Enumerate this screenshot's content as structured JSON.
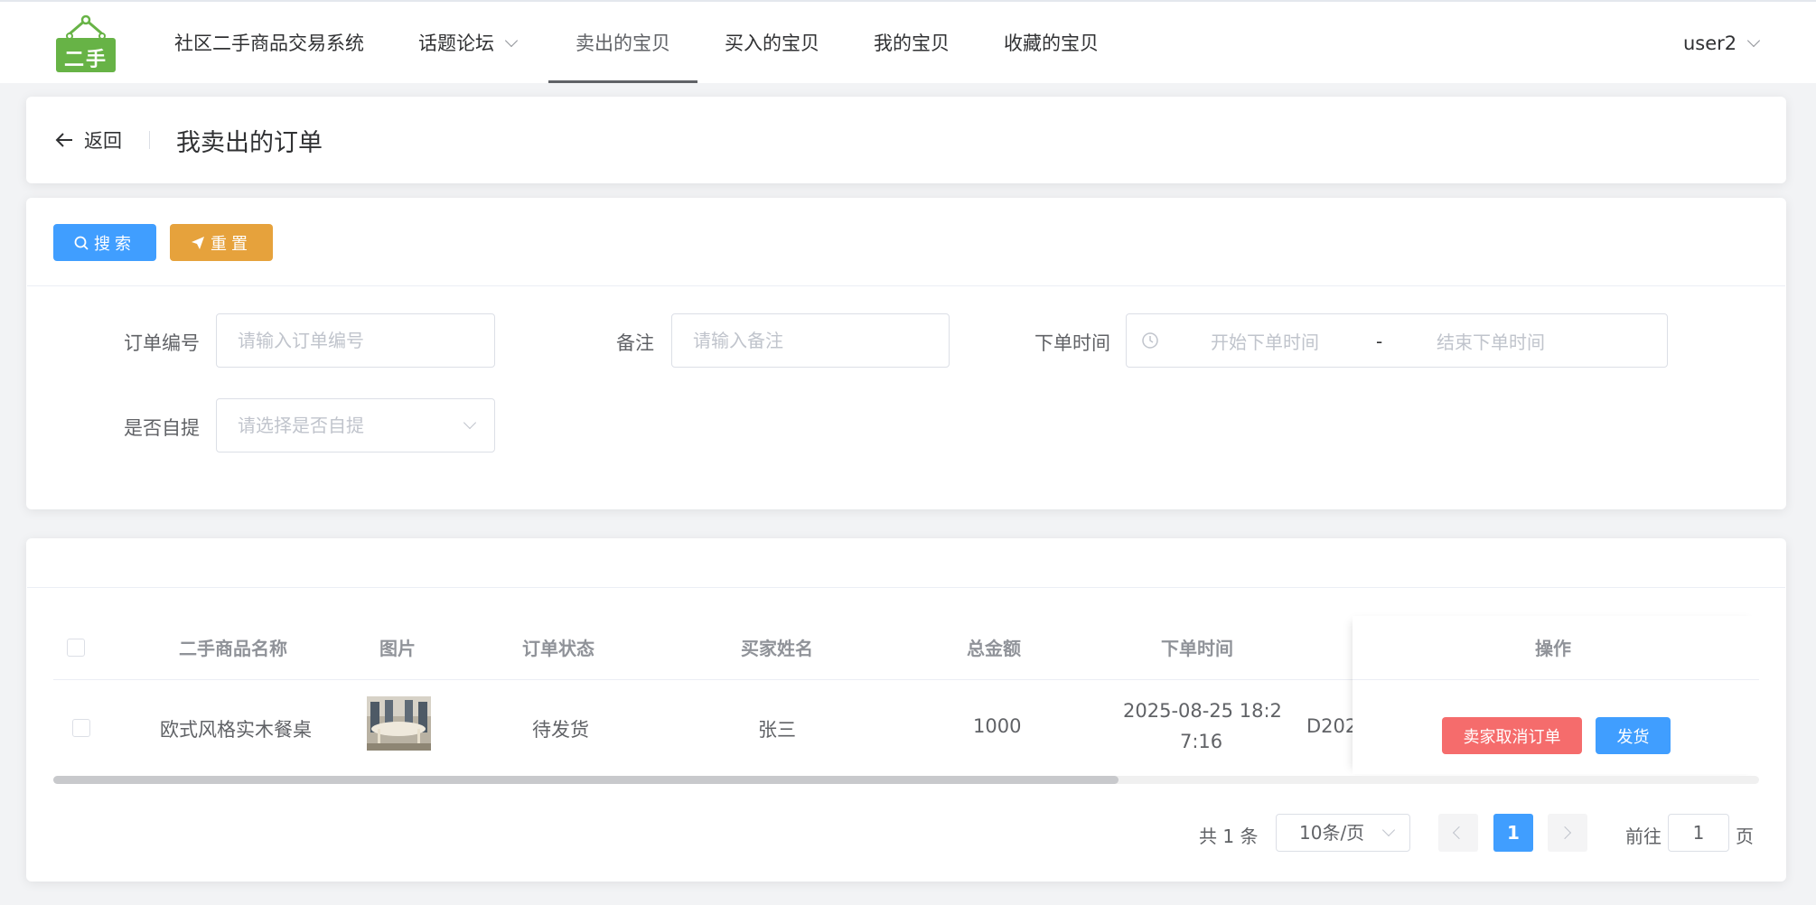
{
  "nav": {
    "logo_text": "二手",
    "brand": "社区二手商品交易系统",
    "items": [
      {
        "label": "话题论坛"
      },
      {
        "label": "卖出的宝贝"
      },
      {
        "label": "买入的宝贝"
      },
      {
        "label": "我的宝贝"
      },
      {
        "label": "收藏的宝贝"
      }
    ],
    "user": "user2"
  },
  "header": {
    "back_label": "返回",
    "title": "我卖出的订单"
  },
  "toolbar": {
    "search_label": "搜索",
    "reset_label": "重置"
  },
  "form": {
    "order_no": {
      "label": "订单编号",
      "placeholder": "请输入订单编号"
    },
    "remark": {
      "label": "备注",
      "placeholder": "请输入备注"
    },
    "order_time": {
      "label": "下单时间",
      "start_placeholder": "开始下单时间",
      "separator": "-",
      "end_placeholder": "结束下单时间"
    },
    "self_pickup": {
      "label": "是否自提",
      "placeholder": "请选择是否自提"
    }
  },
  "table": {
    "columns": [
      "二手商品名称",
      "图片",
      "订单状态",
      "买家姓名",
      "总金额",
      "下单时间",
      "操作"
    ],
    "rows": [
      {
        "name": "欧式风格实木餐桌",
        "status": "待发货",
        "buyer": "张三",
        "total": "1000",
        "time_line1": "2025-08-25 18:2",
        "time_line2": "7:16",
        "order_no_partial": "D202",
        "cancel_label": "卖家取消订单",
        "ship_label": "发货"
      }
    ]
  },
  "pagination": {
    "total_text": "共 1 条",
    "page_size": "10条/页",
    "current_page": "1",
    "goto_label": "前往",
    "goto_value": "1",
    "page_suffix": "页"
  },
  "colors": {
    "primary": "#409eff",
    "warning": "#e6a23c",
    "danger": "#f56c6c",
    "logo_green": "#67b346"
  }
}
